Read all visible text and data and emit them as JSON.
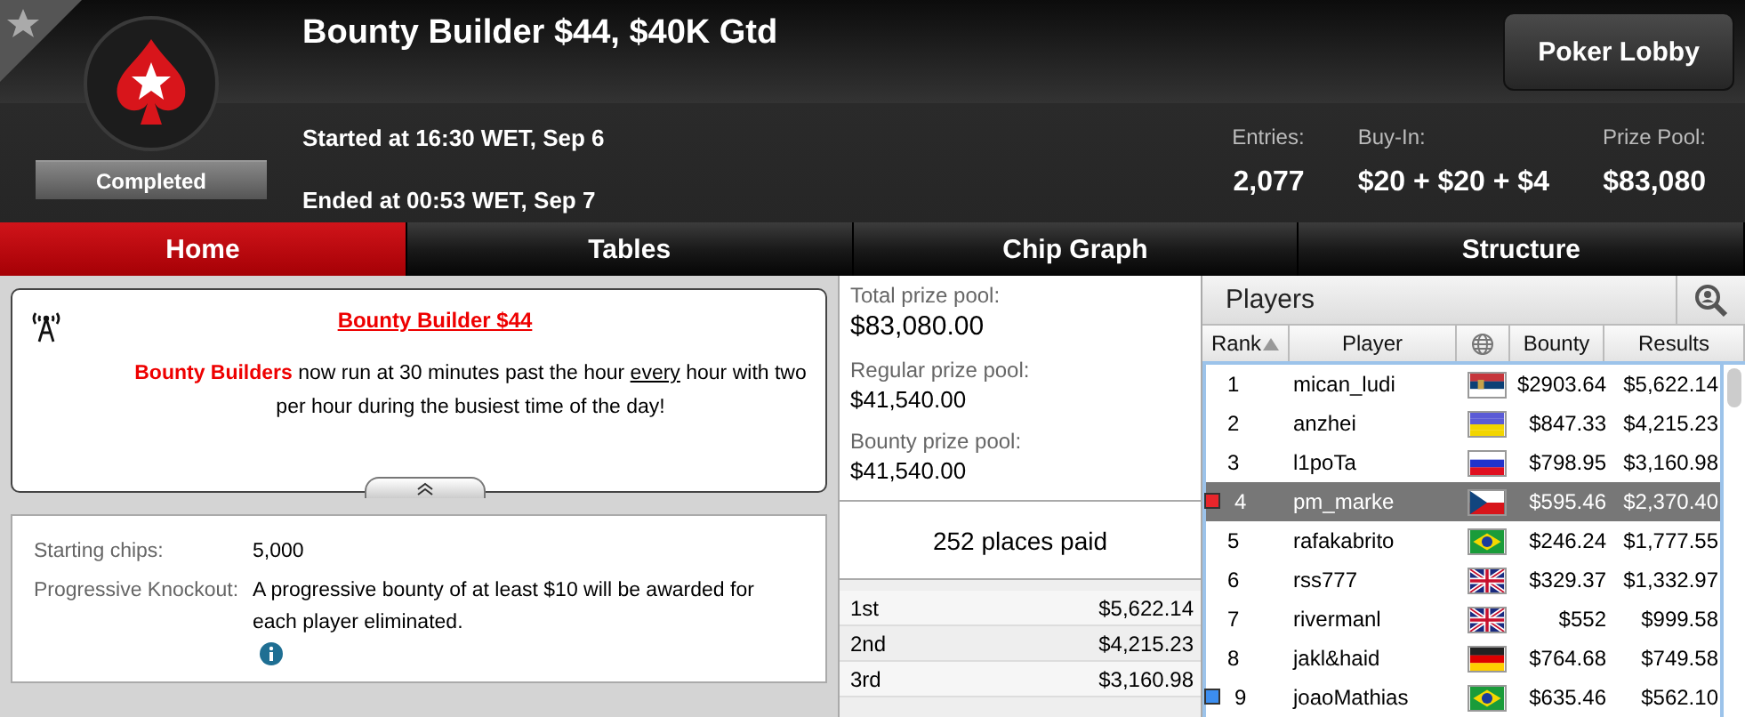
{
  "header": {
    "title": "Bounty Builder $44, $40K Gtd",
    "status": "Completed",
    "started": "Started at 16:30 WET, Sep 6",
    "ended": "Ended at 00:53 WET, Sep 7",
    "lobby_button": "Poker Lobby",
    "stats": [
      {
        "label": "Entries:",
        "value": "2,077"
      },
      {
        "label": "Buy-In:",
        "value": "$20 + $20 + $4"
      },
      {
        "label": "Prize Pool:",
        "value": "$83,080"
      }
    ]
  },
  "tabs": [
    {
      "label": "Home",
      "selected": true
    },
    {
      "label": "Tables",
      "selected": false
    },
    {
      "label": "Chip Graph",
      "selected": false
    },
    {
      "label": "Structure",
      "selected": false
    }
  ],
  "announcement": {
    "title": "Bounty Builder $44",
    "text": "**Bounty Builders** now run at 30 minutes past the hour *every* hour with two per hour during the busiest time of the day!"
  },
  "details": [
    {
      "label": "Starting chips:",
      "value": "5,000",
      "info": false
    },
    {
      "label": "Progressive Knockout:",
      "value": "A progressive bounty of at least $10 will be awarded for each player eliminated.",
      "info": true
    }
  ],
  "prize": {
    "pools": [
      {
        "label": "Total prize pool:",
        "value": "$83,080.00"
      },
      {
        "label": "Regular prize pool:",
        "value": "$41,540.00"
      },
      {
        "label": "Bounty prize pool:",
        "value": "$41,540.00"
      }
    ],
    "places_paid": "252 places paid",
    "payouts": [
      {
        "place": "1st",
        "amount": "$5,622.14"
      },
      {
        "place": "2nd",
        "amount": "$4,215.23"
      },
      {
        "place": "3rd",
        "amount": "$3,160.98"
      }
    ]
  },
  "players": {
    "title": "Players",
    "columns": [
      "Rank",
      "Player",
      "Bounty",
      "Results"
    ],
    "rows": [
      {
        "rank": "1",
        "player": "mican_ludi",
        "kind": "serbia",
        "bounty": "$2903.64",
        "results": "$5,622.14",
        "selected": false
      },
      {
        "rank": "2",
        "player": "anzhei",
        "kind": "ukraine",
        "bounty": "$847.33",
        "results": "$4,215.23",
        "selected": false
      },
      {
        "rank": "3",
        "player": "l1poTa",
        "kind": "russia",
        "bounty": "$798.95",
        "results": "$3,160.98",
        "selected": false
      },
      {
        "rank": "4",
        "player": "pm_marke",
        "kind": "czech",
        "bounty": "$595.46",
        "results": "$2,370.40",
        "selected": true,
        "color": "#e8262b"
      },
      {
        "rank": "5",
        "player": "rafakabrito",
        "kind": "brazil",
        "bounty": "$246.24",
        "results": "$1,777.55",
        "selected": false
      },
      {
        "rank": "6",
        "player": "rss777",
        "kind": "uk",
        "bounty": "$329.37",
        "results": "$1,332.97",
        "selected": false
      },
      {
        "rank": "7",
        "player": "rivermanl",
        "kind": "uk",
        "bounty": "$552",
        "results": "$999.58",
        "selected": false
      },
      {
        "rank": "8",
        "player": "jakl&haid",
        "kind": "germany",
        "bounty": "$764.68",
        "results": "$749.58",
        "selected": false
      },
      {
        "rank": "9",
        "player": "joaoMathias",
        "kind": "brazil",
        "bounty": "$635.46",
        "results": "$562.10",
        "selected": false,
        "color": "#3c8ef0"
      }
    ]
  }
}
